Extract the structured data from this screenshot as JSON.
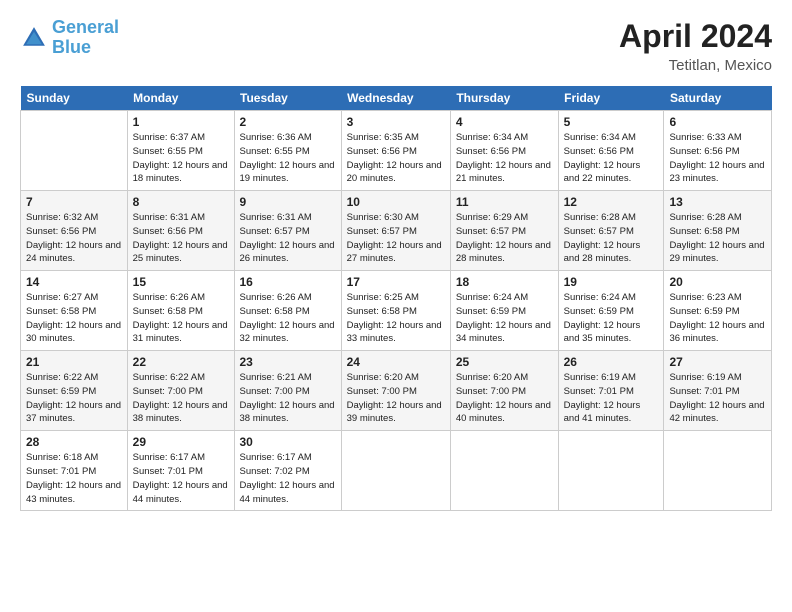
{
  "header": {
    "logo_line1": "General",
    "logo_line2": "Blue",
    "month_year": "April 2024",
    "location": "Tetitlan, Mexico"
  },
  "days_of_week": [
    "Sunday",
    "Monday",
    "Tuesday",
    "Wednesday",
    "Thursday",
    "Friday",
    "Saturday"
  ],
  "weeks": [
    [
      {
        "num": "",
        "sunrise": "",
        "sunset": "",
        "daylight": ""
      },
      {
        "num": "1",
        "sunrise": "Sunrise: 6:37 AM",
        "sunset": "Sunset: 6:55 PM",
        "daylight": "Daylight: 12 hours and 18 minutes."
      },
      {
        "num": "2",
        "sunrise": "Sunrise: 6:36 AM",
        "sunset": "Sunset: 6:55 PM",
        "daylight": "Daylight: 12 hours and 19 minutes."
      },
      {
        "num": "3",
        "sunrise": "Sunrise: 6:35 AM",
        "sunset": "Sunset: 6:56 PM",
        "daylight": "Daylight: 12 hours and 20 minutes."
      },
      {
        "num": "4",
        "sunrise": "Sunrise: 6:34 AM",
        "sunset": "Sunset: 6:56 PM",
        "daylight": "Daylight: 12 hours and 21 minutes."
      },
      {
        "num": "5",
        "sunrise": "Sunrise: 6:34 AM",
        "sunset": "Sunset: 6:56 PM",
        "daylight": "Daylight: 12 hours and 22 minutes."
      },
      {
        "num": "6",
        "sunrise": "Sunrise: 6:33 AM",
        "sunset": "Sunset: 6:56 PM",
        "daylight": "Daylight: 12 hours and 23 minutes."
      }
    ],
    [
      {
        "num": "7",
        "sunrise": "Sunrise: 6:32 AM",
        "sunset": "Sunset: 6:56 PM",
        "daylight": "Daylight: 12 hours and 24 minutes."
      },
      {
        "num": "8",
        "sunrise": "Sunrise: 6:31 AM",
        "sunset": "Sunset: 6:56 PM",
        "daylight": "Daylight: 12 hours and 25 minutes."
      },
      {
        "num": "9",
        "sunrise": "Sunrise: 6:31 AM",
        "sunset": "Sunset: 6:57 PM",
        "daylight": "Daylight: 12 hours and 26 minutes."
      },
      {
        "num": "10",
        "sunrise": "Sunrise: 6:30 AM",
        "sunset": "Sunset: 6:57 PM",
        "daylight": "Daylight: 12 hours and 27 minutes."
      },
      {
        "num": "11",
        "sunrise": "Sunrise: 6:29 AM",
        "sunset": "Sunset: 6:57 PM",
        "daylight": "Daylight: 12 hours and 28 minutes."
      },
      {
        "num": "12",
        "sunrise": "Sunrise: 6:28 AM",
        "sunset": "Sunset: 6:57 PM",
        "daylight": "Daylight: 12 hours and 28 minutes."
      },
      {
        "num": "13",
        "sunrise": "Sunrise: 6:28 AM",
        "sunset": "Sunset: 6:58 PM",
        "daylight": "Daylight: 12 hours and 29 minutes."
      }
    ],
    [
      {
        "num": "14",
        "sunrise": "Sunrise: 6:27 AM",
        "sunset": "Sunset: 6:58 PM",
        "daylight": "Daylight: 12 hours and 30 minutes."
      },
      {
        "num": "15",
        "sunrise": "Sunrise: 6:26 AM",
        "sunset": "Sunset: 6:58 PM",
        "daylight": "Daylight: 12 hours and 31 minutes."
      },
      {
        "num": "16",
        "sunrise": "Sunrise: 6:26 AM",
        "sunset": "Sunset: 6:58 PM",
        "daylight": "Daylight: 12 hours and 32 minutes."
      },
      {
        "num": "17",
        "sunrise": "Sunrise: 6:25 AM",
        "sunset": "Sunset: 6:58 PM",
        "daylight": "Daylight: 12 hours and 33 minutes."
      },
      {
        "num": "18",
        "sunrise": "Sunrise: 6:24 AM",
        "sunset": "Sunset: 6:59 PM",
        "daylight": "Daylight: 12 hours and 34 minutes."
      },
      {
        "num": "19",
        "sunrise": "Sunrise: 6:24 AM",
        "sunset": "Sunset: 6:59 PM",
        "daylight": "Daylight: 12 hours and 35 minutes."
      },
      {
        "num": "20",
        "sunrise": "Sunrise: 6:23 AM",
        "sunset": "Sunset: 6:59 PM",
        "daylight": "Daylight: 12 hours and 36 minutes."
      }
    ],
    [
      {
        "num": "21",
        "sunrise": "Sunrise: 6:22 AM",
        "sunset": "Sunset: 6:59 PM",
        "daylight": "Daylight: 12 hours and 37 minutes."
      },
      {
        "num": "22",
        "sunrise": "Sunrise: 6:22 AM",
        "sunset": "Sunset: 7:00 PM",
        "daylight": "Daylight: 12 hours and 38 minutes."
      },
      {
        "num": "23",
        "sunrise": "Sunrise: 6:21 AM",
        "sunset": "Sunset: 7:00 PM",
        "daylight": "Daylight: 12 hours and 38 minutes."
      },
      {
        "num": "24",
        "sunrise": "Sunrise: 6:20 AM",
        "sunset": "Sunset: 7:00 PM",
        "daylight": "Daylight: 12 hours and 39 minutes."
      },
      {
        "num": "25",
        "sunrise": "Sunrise: 6:20 AM",
        "sunset": "Sunset: 7:00 PM",
        "daylight": "Daylight: 12 hours and 40 minutes."
      },
      {
        "num": "26",
        "sunrise": "Sunrise: 6:19 AM",
        "sunset": "Sunset: 7:01 PM",
        "daylight": "Daylight: 12 hours and 41 minutes."
      },
      {
        "num": "27",
        "sunrise": "Sunrise: 6:19 AM",
        "sunset": "Sunset: 7:01 PM",
        "daylight": "Daylight: 12 hours and 42 minutes."
      }
    ],
    [
      {
        "num": "28",
        "sunrise": "Sunrise: 6:18 AM",
        "sunset": "Sunset: 7:01 PM",
        "daylight": "Daylight: 12 hours and 43 minutes."
      },
      {
        "num": "29",
        "sunrise": "Sunrise: 6:17 AM",
        "sunset": "Sunset: 7:01 PM",
        "daylight": "Daylight: 12 hours and 44 minutes."
      },
      {
        "num": "30",
        "sunrise": "Sunrise: 6:17 AM",
        "sunset": "Sunset: 7:02 PM",
        "daylight": "Daylight: 12 hours and 44 minutes."
      },
      {
        "num": "",
        "sunrise": "",
        "sunset": "",
        "daylight": ""
      },
      {
        "num": "",
        "sunrise": "",
        "sunset": "",
        "daylight": ""
      },
      {
        "num": "",
        "sunrise": "",
        "sunset": "",
        "daylight": ""
      },
      {
        "num": "",
        "sunrise": "",
        "sunset": "",
        "daylight": ""
      }
    ]
  ]
}
